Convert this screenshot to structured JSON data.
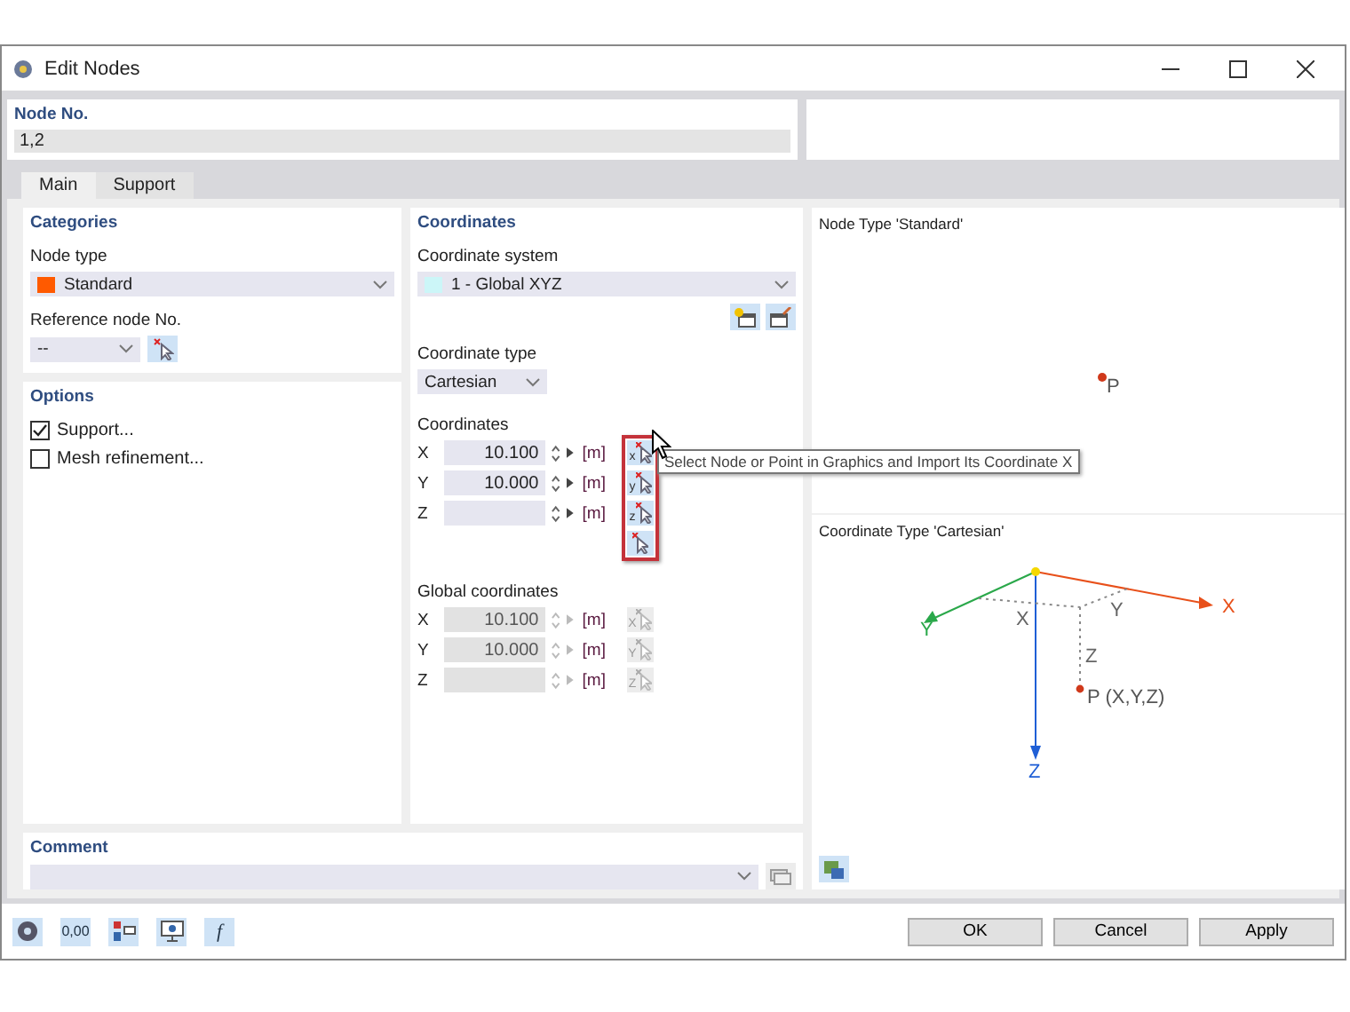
{
  "window": {
    "title": "Edit Nodes"
  },
  "node_no": {
    "label": "Node No.",
    "value": "1,2"
  },
  "tabs": [
    {
      "label": "Main",
      "selected": true
    },
    {
      "label": "Support",
      "selected": false
    }
  ],
  "categories": {
    "title": "Categories",
    "node_type_label": "Node type",
    "node_type": {
      "value": "Standard",
      "color": "#ff5a00"
    },
    "reference_label": "Reference node No.",
    "reference_value": "--"
  },
  "options": {
    "title": "Options",
    "items": [
      {
        "label": "Support...",
        "checked": true
      },
      {
        "label": "Mesh refinement...",
        "checked": false
      }
    ]
  },
  "coordinates": {
    "title": "Coordinates",
    "system_label": "Coordinate system",
    "system": {
      "value": "1 - Global XYZ",
      "color": "#ccf6f8"
    },
    "type_label": "Coordinate type",
    "type_value": "Cartesian",
    "coords_label": "Coordinates",
    "coords": [
      {
        "axis": "X",
        "value": "10.100",
        "unit": "[m]",
        "pick": "x"
      },
      {
        "axis": "Y",
        "value": "10.000",
        "unit": "[m]",
        "pick": "y"
      },
      {
        "axis": "Z",
        "unit": "[m]",
        "pick": "z"
      }
    ],
    "global_label": "Global coordinates",
    "global": [
      {
        "axis": "X",
        "value": "10.100",
        "unit": "[m]",
        "pick": "X"
      },
      {
        "axis": "Y",
        "value": "10.000",
        "unit": "[m]",
        "pick": "Y"
      },
      {
        "axis": "Z",
        "unit": "[m]",
        "pick": "Z"
      }
    ]
  },
  "tooltip": "Select Node or Point in Graphics and Import Its Coordinate X",
  "preview": {
    "node_title": "Node Type 'Standard'",
    "node_label": "P",
    "coord_title": "Coordinate Type 'Cartesian'",
    "axes": [
      {
        "label": "X",
        "color": "#e8501a"
      },
      {
        "label": "Y",
        "color": "#2aa84a"
      },
      {
        "label": "Z",
        "color": "#1f5fd6"
      }
    ],
    "components": [
      "X",
      "Y",
      "Z"
    ],
    "point_label": "P (X,Y,Z)"
  },
  "comment": {
    "label": "Comment"
  },
  "footer_tools": [
    {
      "kind": "help"
    },
    {
      "kind": "units",
      "text": "0,00"
    },
    {
      "kind": "model"
    },
    {
      "kind": "view"
    },
    {
      "kind": "function",
      "text": "f"
    }
  ],
  "buttons": [
    "OK",
    "Cancel",
    "Apply"
  ]
}
